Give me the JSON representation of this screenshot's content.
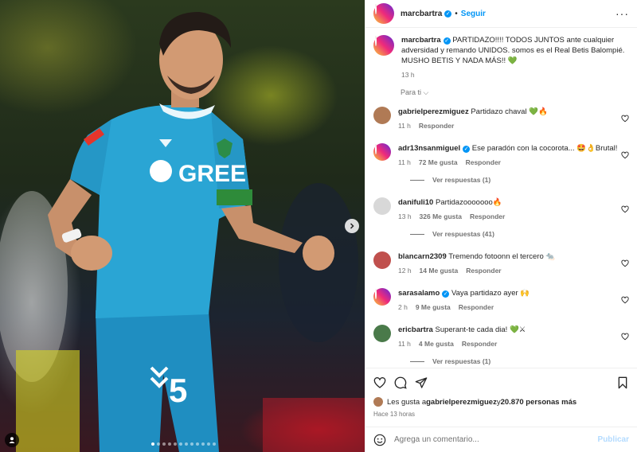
{
  "post": {
    "username": "marcbartra",
    "follow_label": "Seguir",
    "more_label": "···",
    "caption_user": "marcbartra",
    "caption": "PARTIDAZO!!!! TODOS JUNTOS ante cualquier adversidad y remando UNIDOS. somos es el Real Betis Balompié. MUSHO BETIS Y NADA MÁS!! 💚",
    "caption_time": "13 h",
    "sort_label": "Para ti ⌵"
  },
  "photo": {
    "sponsor_text": "GREE",
    "shirt_number": "5",
    "carousel_dots": 12,
    "active_dot": 0
  },
  "comments": [
    {
      "user": "gabrielperezmiguez",
      "verified": false,
      "text": "Partidazo chaval 💚🔥",
      "time": "11 h",
      "likes": "",
      "reply": "Responder",
      "replies": "",
      "avatar": "#b07a55"
    },
    {
      "user": "adr13nsanmiguel",
      "verified": true,
      "text": "Ese paradón con la cocorota... 🤩👌Brutal!",
      "time": "11 h",
      "likes": "72 Me gusta",
      "reply": "Responder",
      "replies": "Ver respuestas (1)",
      "avatar": "#9c6b4e"
    },
    {
      "user": "danifuli10",
      "verified": false,
      "text": "Partidazooooooo🔥",
      "time": "13 h",
      "likes": "326 Me gusta",
      "reply": "Responder",
      "replies": "Ver respuestas (41)",
      "avatar": "#d8d8d8"
    },
    {
      "user": "blancarn2309",
      "verified": false,
      "text": "Tremendo fotoonn el tercero 🐀",
      "time": "12 h",
      "likes": "14 Me gusta",
      "reply": "Responder",
      "replies": "",
      "avatar": "#c0504d"
    },
    {
      "user": "sarasalamo",
      "verified": true,
      "text": "Vaya partidazo ayer 🙌",
      "time": "2 h",
      "likes": "9 Me gusta",
      "reply": "Responder",
      "replies": "",
      "avatar": "#c9a27e"
    },
    {
      "user": "ericbartra",
      "verified": false,
      "text": "Superant-te cada dia! 💚⚔",
      "time": "11 h",
      "likes": "4 Me gusta",
      "reply": "Responder",
      "replies": "Ver respuestas (1)",
      "avatar": "#4a7a4a"
    }
  ],
  "likes": {
    "prefix": "Les gusta a ",
    "user": "gabrielperezmiguez",
    "middle": " y ",
    "count": "20.870 personas más"
  },
  "date": "Hace 13 horas",
  "composer": {
    "placeholder": "Agrega un comentario...",
    "publish_label": "Publicar"
  },
  "colors": {
    "accent": "#0095f6",
    "jersey": "#2aa5d4"
  }
}
